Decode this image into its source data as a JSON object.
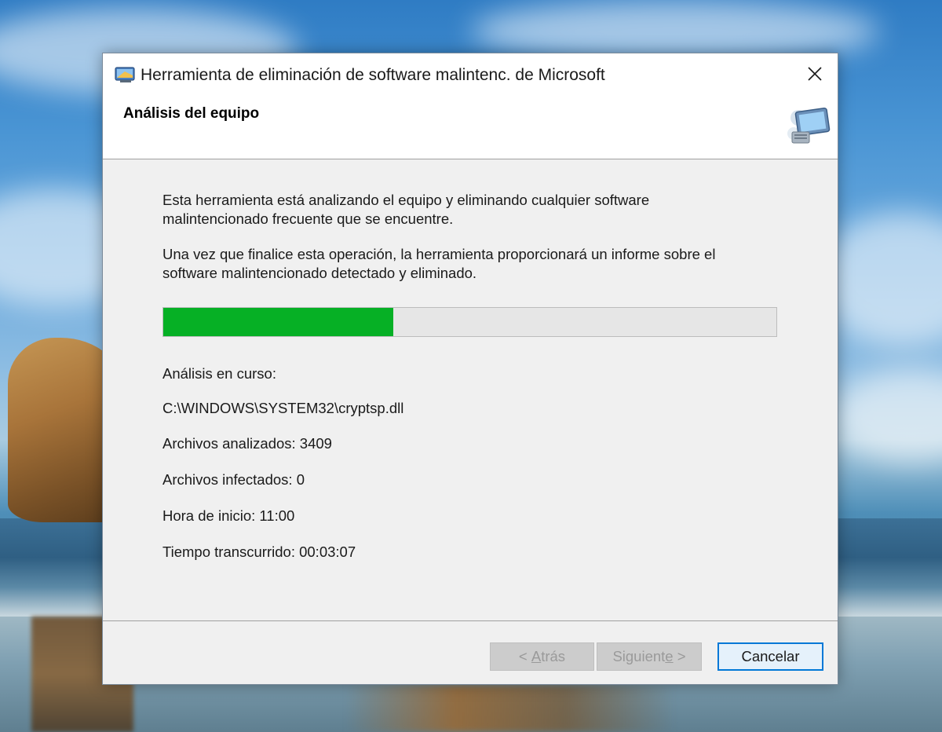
{
  "window": {
    "title": "Herramienta de eliminación de software malintenc. de Microsoft",
    "close_glyph": "✕",
    "header_title": "Análisis del equipo"
  },
  "content": {
    "paragraph_1_line_1": "Esta herramienta está analizando el equipo y eliminando cualquier software",
    "paragraph_1_line_2": "malintencionado frecuente que se encuentre.",
    "paragraph_2_line_1": "Una vez que finalice esta operación, la herramienta proporcionará un informe sobre el",
    "paragraph_2_line_2": "software malintencionado detectado y eliminado.",
    "progress_fraction": 0.375,
    "progress_color": "#06b025",
    "status_label": "Análisis en curso:",
    "current_file": "C:\\WINDOWS\\SYSTEM32\\cryptsp.dll",
    "files_scanned": "Archivos analizados: 3409",
    "files_infected": "Archivos infectados: 0",
    "start_time": "Hora de inicio: 11:00",
    "elapsed_time": "Tiempo transcurrido: 00:03:07"
  },
  "buttons": {
    "back_prefix": "< ",
    "back_accel": "A",
    "back_rest": "trás",
    "next_prefix": "Siguient",
    "next_accel": "e",
    "next_suffix": " >",
    "cancel": "Cancelar"
  },
  "icons": {
    "app_icon": "mrt-app-icon",
    "header_icon": "computer-scan-icon",
    "close_icon": "close-icon"
  },
  "colors": {
    "accent": "#0078d7",
    "progress": "#06b025"
  }
}
